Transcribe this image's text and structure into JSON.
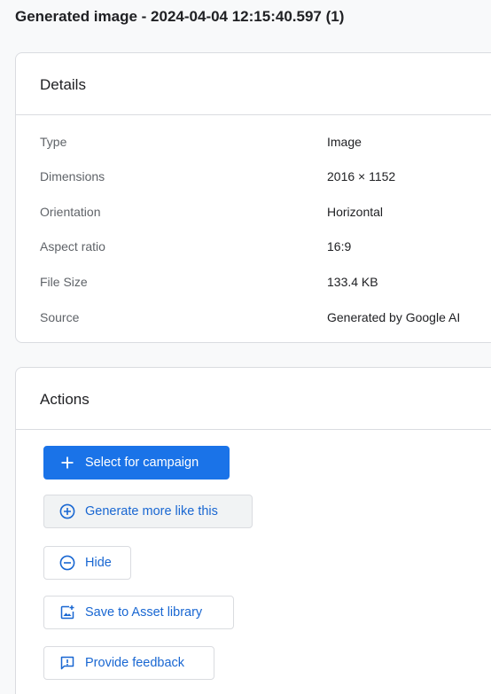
{
  "title": "Generated image - 2024-04-04 12:15:40.597 (1)",
  "details": {
    "heading": "Details",
    "rows": [
      {
        "label": "Type",
        "value": "Image"
      },
      {
        "label": "Dimensions",
        "value": "2016 × 1152"
      },
      {
        "label": "Orientation",
        "value": "Horizontal"
      },
      {
        "label": "Aspect ratio",
        "value": "16:9"
      },
      {
        "label": "File Size",
        "value": "133.4 KB"
      },
      {
        "label": "Source",
        "value": "Generated by Google AI"
      }
    ]
  },
  "actions": {
    "heading": "Actions",
    "buttons": [
      {
        "label": "Select for campaign",
        "icon": "plus-icon"
      },
      {
        "label": "Generate more like this",
        "icon": "add-circle-icon"
      },
      {
        "label": "Hide",
        "icon": "remove-circle-icon"
      },
      {
        "label": "Save to Asset library",
        "icon": "add-photo-icon"
      },
      {
        "label": "Provide feedback",
        "icon": "feedback-icon"
      }
    ]
  },
  "colors": {
    "primary": "#1a73e8",
    "link": "#1967d2",
    "border": "#dadce0",
    "background": "#f8f9fa"
  }
}
